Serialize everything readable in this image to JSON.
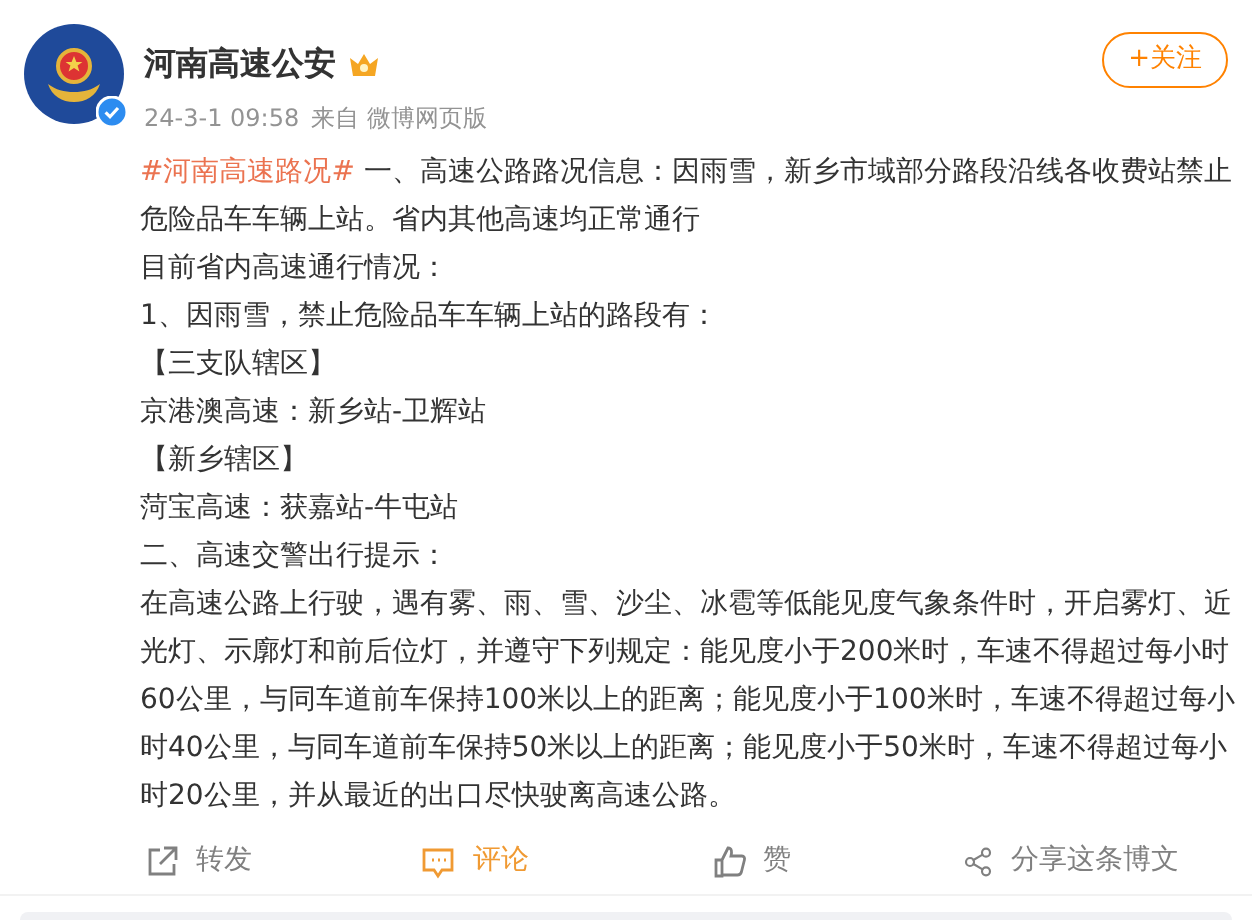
{
  "author": {
    "name": "河南高速公安",
    "verified": true
  },
  "meta": {
    "time": "24-3-1 09:58",
    "source": "来自 微博网页版"
  },
  "follow_button": "+关注",
  "post": {
    "topic": "#河南高速路况#",
    "paragraphs": [
      "一、高速公路路况信息：因雨雪，新乡市域部分路段沿线各收费站禁止危险品车车辆上站。省内其他高速均正常通行",
      "目前省内高速通行情况：",
      "1、因雨雪，禁止危险品车车辆上站的路段有：",
      "【三支队辖区】",
      "京港澳高速：新乡站-卫辉站",
      "【新乡辖区】",
      "菏宝高速：获嘉站-牛屯站",
      "二、高速交警出行提示：",
      "在高速公路上行驶，遇有雾、雨、雪、沙尘、冰雹等低能见度气象条件时，开启雾灯、近光灯、示廓灯和前后位灯，并遵守下列规定：能见度小于200米时，车速不得超过每小时60公里，与同车道前车保持100米以上的距离；能见度小于100米时，车速不得超过每小时40公里，与同车道前车保持50米以上的距离；能见度小于50米时，车速不得超过每小时20公里，并从最近的出口尽快驶离高速公路。"
    ]
  },
  "actions": [
    {
      "kind": "repost",
      "label": "转发",
      "selected": false
    },
    {
      "kind": "comment",
      "label": "评论",
      "selected": true
    },
    {
      "kind": "like",
      "label": "赞",
      "selected": false
    },
    {
      "kind": "share",
      "label": "分享这条博文",
      "selected": false
    }
  ]
}
